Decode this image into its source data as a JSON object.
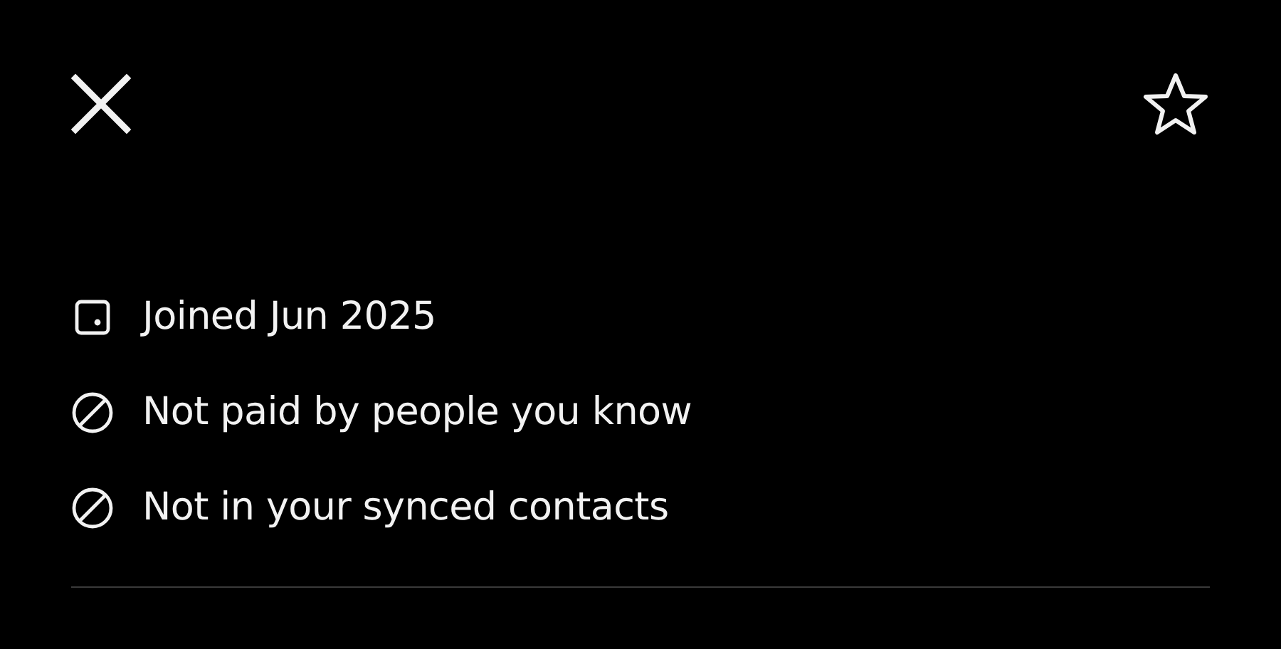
{
  "header": {
    "close": true,
    "favorite": {
      "selected": false
    }
  },
  "details": [
    {
      "kind": "calendar",
      "text": "Joined Jun 2025"
    },
    {
      "kind": "blocked",
      "text": "Not paid by people you know"
    },
    {
      "kind": "blocked",
      "text": "Not in your synced contacts"
    }
  ]
}
